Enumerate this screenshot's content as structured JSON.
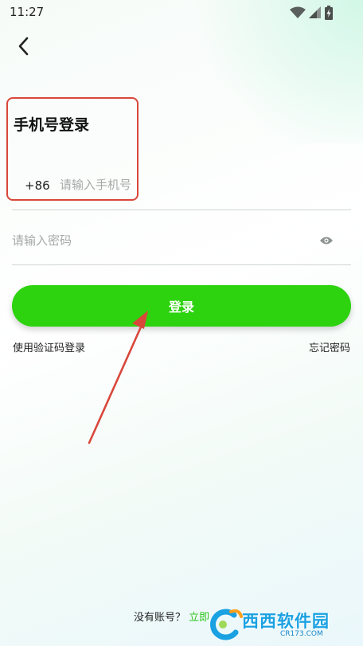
{
  "status_bar": {
    "time": "11:27",
    "icons": [
      "wifi-icon",
      "signal-icon",
      "battery-icon"
    ]
  },
  "header": {
    "back_icon": "chevron-left-icon"
  },
  "login": {
    "title": "手机号登录",
    "country_code": "+86",
    "phone_placeholder": "请输入手机号",
    "password_placeholder": "请输入密码",
    "password_toggle_icon": "eye-icon",
    "submit_label": "登录",
    "sms_login_link": "使用验证码登录",
    "forgot_password_link": "忘记密码"
  },
  "footer": {
    "no_account_text": "没有账号？",
    "register_link": "立即"
  },
  "watermark": {
    "main_text": "西西软件园",
    "url_text": "CR173.COM"
  },
  "colors": {
    "accent": "#2dd30f",
    "highlight": "#d9473b",
    "link_green": "#2dc41c",
    "watermark_blue": "#1aa1e2"
  }
}
